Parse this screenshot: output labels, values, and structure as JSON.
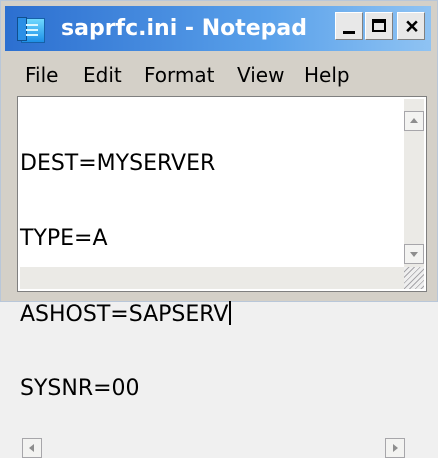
{
  "window": {
    "title": "saprfc.ini - Notepad",
    "buttons": {
      "minimize_icon": "minimize-icon",
      "maximize_icon": "maximize-icon",
      "close_icon": "close-icon"
    }
  },
  "menu": [
    {
      "label": "File"
    },
    {
      "label": "Edit"
    },
    {
      "label": "Format"
    },
    {
      "label": "View"
    },
    {
      "label": "Help"
    }
  ],
  "editor": {
    "lines": [
      "DEST=MYSERVER",
      "TYPE=A",
      "ASHOST=SAPSERV",
      "SYSNR=00"
    ]
  },
  "colors": {
    "titlebar_start": "#2c6fd0",
    "titlebar_end": "#8fc3f3",
    "menu_background": "#d4d0c8",
    "editor_background": "#ffffff"
  }
}
